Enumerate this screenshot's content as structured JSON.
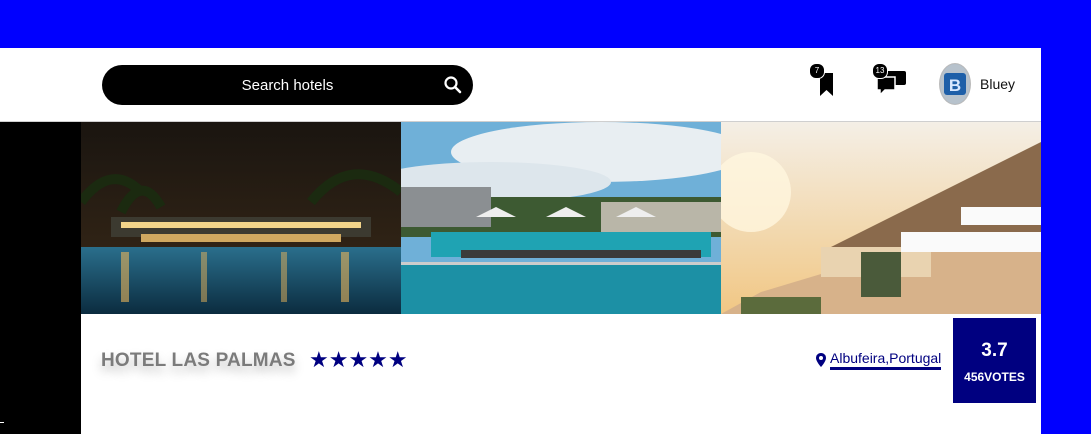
{
  "header": {
    "search_placeholder": "Search hotels",
    "bookmarks_count": "7",
    "messages_count": "13",
    "username": "Bluey",
    "search_icon": "search-icon",
    "bookmark_icon": "bookmark-icon",
    "messages_icon": "chat-icon"
  },
  "gallery": {
    "photos": [
      "night-pool-photo",
      "resort-pool-photo",
      "cliff-terrace-photo"
    ]
  },
  "hotel": {
    "name": "HOTEL LAS PALMAS",
    "stars": "★★★★★",
    "star_rating": 5,
    "location": "Albufeira,Portugal",
    "score": "3.7",
    "votes": "456VOTES"
  },
  "colors": {
    "background": "#0000ff",
    "accent": "#000080",
    "search_bg": "#000000"
  }
}
